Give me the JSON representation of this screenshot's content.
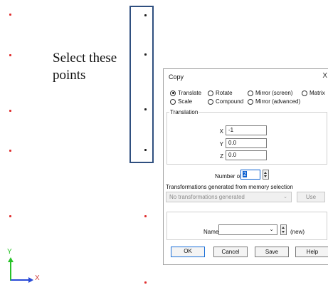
{
  "canvas": {
    "callout_text": "Select these points",
    "axes": {
      "x_label": "X",
      "y_label": "Y"
    },
    "colors": {
      "point_red": "#e03030",
      "point_black": "#222222",
      "selection_box": "#2f4f7f"
    }
  },
  "dialog": {
    "title": "Copy",
    "close_glyph": "X",
    "radios": {
      "translate": "Translate",
      "rotate": "Rotate",
      "mirror_screen": "Mirror (screen)",
      "matrix": "Matrix",
      "scale": "Scale",
      "compound": "Compound",
      "mirror_advanced": "Mirror (advanced)",
      "selected": "Translate"
    },
    "translation": {
      "group_label": "Translation",
      "x_label": "X",
      "x_value": "-1",
      "y_label": "Y",
      "y_value": "0.0",
      "z_label": "Z",
      "z_value": "0.0"
    },
    "copies": {
      "label": "Number of copies",
      "value": "2"
    },
    "memory": {
      "label": "Transformations generated from memory selection",
      "select_value": "No transformations generated",
      "use_button": "Use"
    },
    "name": {
      "label": "Name",
      "value": "",
      "suffix": "(new)"
    },
    "buttons": {
      "ok": "OK",
      "cancel": "Cancel",
      "save": "Save",
      "help": "Help"
    },
    "accent_color": "#1a6fd8"
  }
}
